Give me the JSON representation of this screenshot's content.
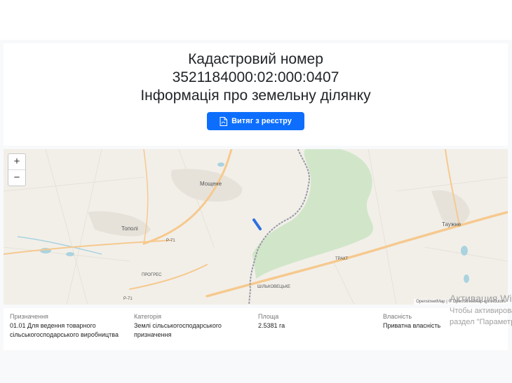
{
  "header": {
    "cadastral_title": "Кадастровий номер",
    "cadastral_number": "3521184000:02:000:0407",
    "subtitle": "Інформація про земельну ділянку",
    "extract_button": "Витяг з реєстру"
  },
  "map": {
    "zoom_in": "+",
    "zoom_out": "−",
    "places": {
      "moshchene": "Мощене",
      "topoli": "Тополі",
      "tauzhne": "Таужне",
      "road_r71a": "Р-71",
      "road_r71b": "Р-71",
      "progres": "ПРОГРЕС",
      "trakt": "ТРАКТ",
      "silkovetska": "ШІЛЬКОВЕЦЬКЕ"
    },
    "attribution": "OpenstreetMap | © OpenStreetMap contributors",
    "colors": {
      "background": "#f2efe9",
      "forest": "#d1e6c9",
      "road": "#f6c98e",
      "boundary": "#9a9aa6",
      "parcel": "#2f6fe0"
    }
  },
  "info": {
    "purpose": {
      "label": "Призначення",
      "value": "01.01 Для ведення товарного сільськогосподарського виробництва"
    },
    "category": {
      "label": "Категорія",
      "value": "Землі сільськогосподарського призначення"
    },
    "area": {
      "label": "Площа",
      "value": "2.5381 га"
    },
    "ownership": {
      "label": "Власність",
      "value": "Приватна власність"
    }
  },
  "watermark": {
    "line1": "Активация Windows",
    "line2": "Чтобы активировать Windows, перейдите в",
    "line3": "раздел \"Параметры\"."
  }
}
